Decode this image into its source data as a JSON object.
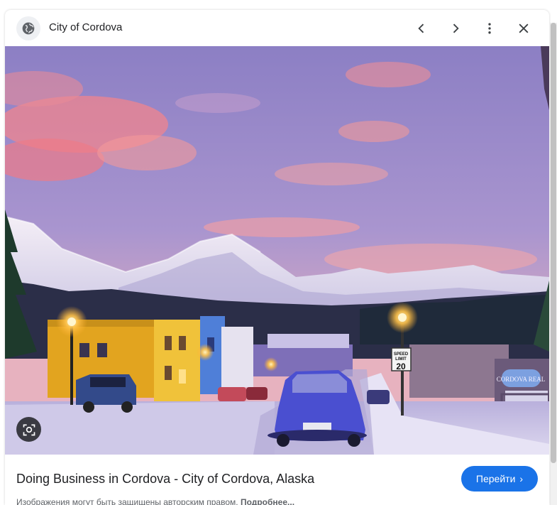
{
  "header": {
    "site_name": "City of Cordova",
    "site_icon": "globe-icon",
    "buttons": [
      "chevron-left-icon",
      "chevron-right-icon",
      "more-vert-icon",
      "close-icon"
    ]
  },
  "image": {
    "lens_icon": "lens-search-icon",
    "sign_speed": "SPEED",
    "sign_limit": "LIMIT",
    "sign_value": "20",
    "store_sign": "CORDOVA REAL"
  },
  "footer": {
    "caption": "Doing Business in Cordova - City of Cordova, Alaska",
    "visit_label": "Перейти",
    "visit_chevron": "›",
    "copyright_text": "Изображения могут быть защищены авторским правом.",
    "more_link": "Подробнее..."
  },
  "colors": {
    "accent": "#1a73e8",
    "sky_top": "#8a7fc6",
    "cloud_pink": "#f28a8a"
  }
}
